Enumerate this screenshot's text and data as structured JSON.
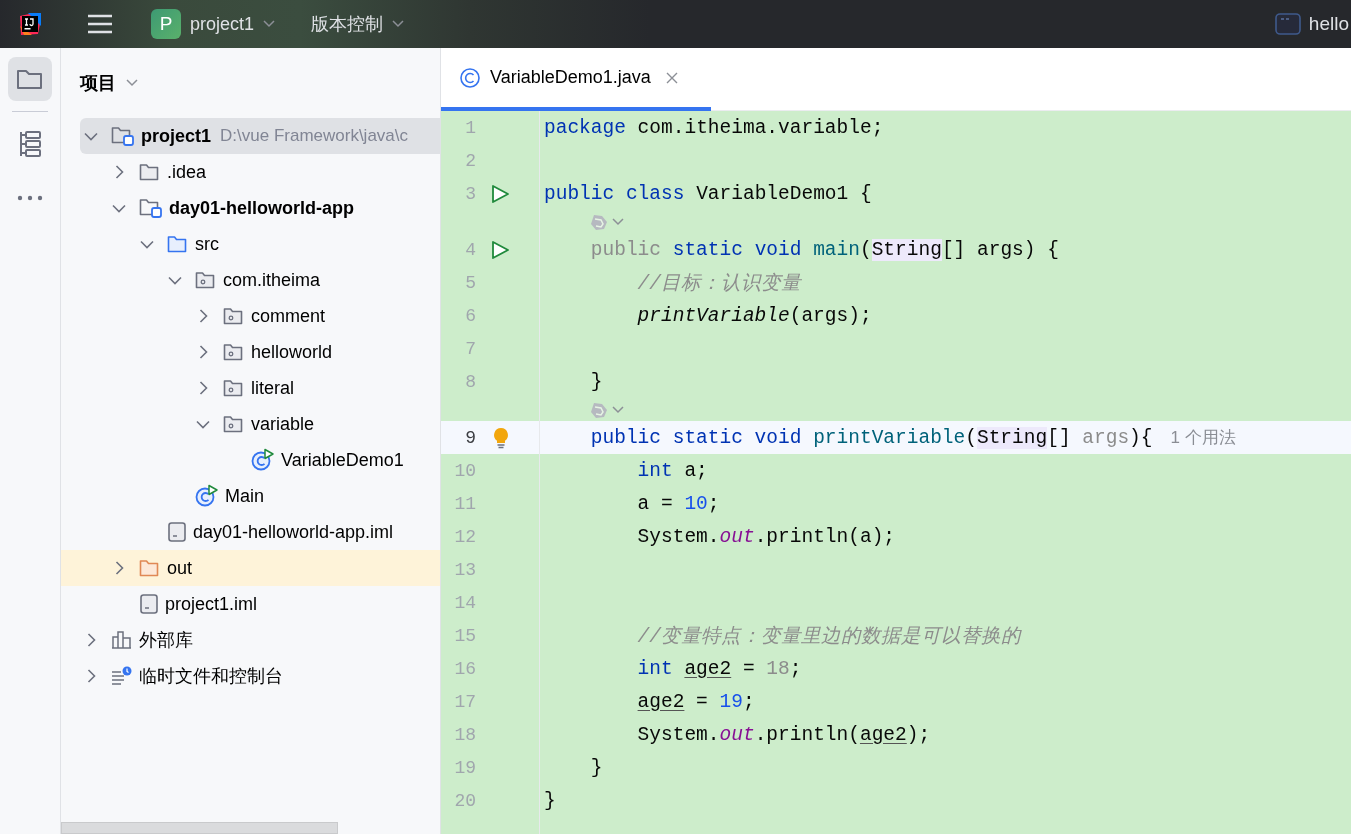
{
  "titlebar": {
    "project_badge": "P",
    "project": "project1",
    "vcs": "版本控制",
    "run_config": "hello"
  },
  "toolstrip": [
    {
      "kind": "project",
      "selected": true
    },
    {
      "kind": "structure",
      "selected": false
    },
    {
      "kind": "more",
      "selected": false
    }
  ],
  "project_panel": {
    "title": "项目",
    "tree": [
      {
        "label": "project1",
        "kind": "module",
        "path": "D:\\vue  Framework\\java\\c",
        "expanded": true,
        "selected": true,
        "children": [
          {
            "label": ".idea",
            "kind": "folder",
            "expanded": false,
            "selected": false
          },
          {
            "label": "day01-helloworld-app",
            "kind": "module",
            "expanded": true,
            "selected": false,
            "children": [
              {
                "label": "src",
                "kind": "source",
                "expanded": true,
                "selected": false,
                "children": [
                  {
                    "label": "com.itheima",
                    "kind": "package",
                    "expanded": true,
                    "selected": false,
                    "children": [
                      {
                        "label": "comment",
                        "kind": "package",
                        "expanded": false,
                        "selected": false
                      },
                      {
                        "label": "helloworld",
                        "kind": "package",
                        "expanded": false,
                        "selected": false
                      },
                      {
                        "label": "literal",
                        "kind": "package",
                        "expanded": false,
                        "selected": false
                      },
                      {
                        "label": "variable",
                        "kind": "package",
                        "expanded": true,
                        "selected": false,
                        "children": [
                          {
                            "label": "VariableDemo1",
                            "kind": "class",
                            "selected": false
                          }
                        ]
                      }
                    ]
                  },
                  {
                    "label": "Main",
                    "kind": "class",
                    "selected": false
                  }
                ]
              },
              {
                "label": "day01-helloworld-app.iml",
                "kind": "file",
                "selected": false
              }
            ]
          },
          {
            "label": "out",
            "kind": "excluded",
            "expanded": false,
            "selected": false
          },
          {
            "label": "project1.iml",
            "kind": "file",
            "selected": false
          }
        ]
      },
      {
        "label": "外部库",
        "kind": "library",
        "expanded": false,
        "selected": false
      },
      {
        "label": "临时文件和控制台",
        "kind": "scratch",
        "expanded": false,
        "selected": false
      }
    ]
  },
  "editor": {
    "tabs": [
      {
        "label": "VariableDemo1.java",
        "selected": true
      }
    ],
    "lines": [
      {
        "kind": "code",
        "number": "1",
        "current": false,
        "tokens": [
          {
            "t": "package",
            "kind": "kw"
          },
          {
            "t": " com.itheima.variable;"
          }
        ]
      },
      {
        "kind": "code",
        "number": "2",
        "current": false
      },
      {
        "kind": "code",
        "number": "3",
        "current": false,
        "marker": {
          "kind": "run"
        },
        "tokens": [
          {
            "t": "public class",
            "kind": "kw"
          },
          {
            "t": " VariableDemo1 {"
          }
        ]
      },
      {
        "kind": "hint"
      },
      {
        "kind": "code",
        "number": "4",
        "current": false,
        "marker": {
          "kind": "run"
        },
        "tokens": [
          {
            "t": "    public",
            "kind": "dim"
          },
          {
            "t": " static void",
            "kind": "kw"
          },
          {
            "t": " main",
            "kind": "fn"
          },
          {
            "t": "("
          },
          {
            "t": "String",
            "kind": "hl"
          },
          {
            "t": "[] args) {"
          }
        ]
      },
      {
        "kind": "code",
        "number": "5",
        "current": false,
        "tokens": [
          {
            "t": "        //目标：认识变量",
            "kind": "comment"
          }
        ]
      },
      {
        "kind": "code",
        "number": "6",
        "current": false,
        "tokens": [
          {
            "t": "        printVariable",
            "kind": "call"
          },
          {
            "t": "(args);"
          }
        ]
      },
      {
        "kind": "code",
        "number": "7",
        "current": false
      },
      {
        "kind": "code",
        "number": "8",
        "current": false,
        "tokens": [
          {
            "t": "    }"
          }
        ]
      },
      {
        "kind": "hint"
      },
      {
        "kind": "code",
        "number": "9",
        "current": true,
        "marker": {
          "kind": "bulb"
        },
        "usage": "1 个用法",
        "tokens": [
          {
            "t": "    public static void",
            "kind": "kw"
          },
          {
            "t": " printVariable",
            "kind": "fn"
          },
          {
            "t": "("
          },
          {
            "t": "String",
            "kind": "hl"
          },
          {
            "t": "[] "
          },
          {
            "t": "args",
            "kind": "dim"
          },
          {
            "t": "){"
          }
        ]
      },
      {
        "kind": "code",
        "number": "10",
        "current": false,
        "tokens": [
          {
            "t": "        int",
            "kind": "kw"
          },
          {
            "t": " a;"
          }
        ]
      },
      {
        "kind": "code",
        "number": "11",
        "current": false,
        "tokens": [
          {
            "t": "        a = "
          },
          {
            "t": "10",
            "kind": "num"
          },
          {
            "t": ";"
          }
        ]
      },
      {
        "kind": "code",
        "number": "12",
        "current": false,
        "tokens": [
          {
            "t": "        System."
          },
          {
            "t": "out",
            "kind": "field"
          },
          {
            "t": ".println(a);"
          }
        ]
      },
      {
        "kind": "code",
        "number": "13",
        "current": false
      },
      {
        "kind": "code",
        "number": "14",
        "current": false
      },
      {
        "kind": "code",
        "number": "15",
        "current": false,
        "tokens": [
          {
            "t": "        //变量特点：变量里边的数据是可以替换的",
            "kind": "comment"
          }
        ]
      },
      {
        "kind": "code",
        "number": "16",
        "current": false,
        "tokens": [
          {
            "t": "        int ",
            "kind": "kw"
          },
          {
            "t": "age2",
            "kind": "ul"
          },
          {
            "t": " = "
          },
          {
            "t": "18",
            "kind": "dim"
          },
          {
            "t": ";"
          }
        ]
      },
      {
        "kind": "code",
        "number": "17",
        "current": false,
        "tokens": [
          {
            "t": "        age2",
            "kind": "ul"
          },
          {
            "t": " = "
          },
          {
            "t": "19",
            "kind": "num"
          },
          {
            "t": ";"
          }
        ]
      },
      {
        "kind": "code",
        "number": "18",
        "current": false,
        "tokens": [
          {
            "t": "        System."
          },
          {
            "t": "out",
            "kind": "field"
          },
          {
            "t": ".println("
          },
          {
            "t": "age2",
            "kind": "ul"
          },
          {
            "t": ");"
          }
        ]
      },
      {
        "kind": "code",
        "number": "19",
        "current": false,
        "tokens": [
          {
            "t": "    }"
          }
        ]
      },
      {
        "kind": "code",
        "number": "20",
        "current": false,
        "tokens": [
          {
            "t": "}"
          }
        ]
      }
    ]
  }
}
